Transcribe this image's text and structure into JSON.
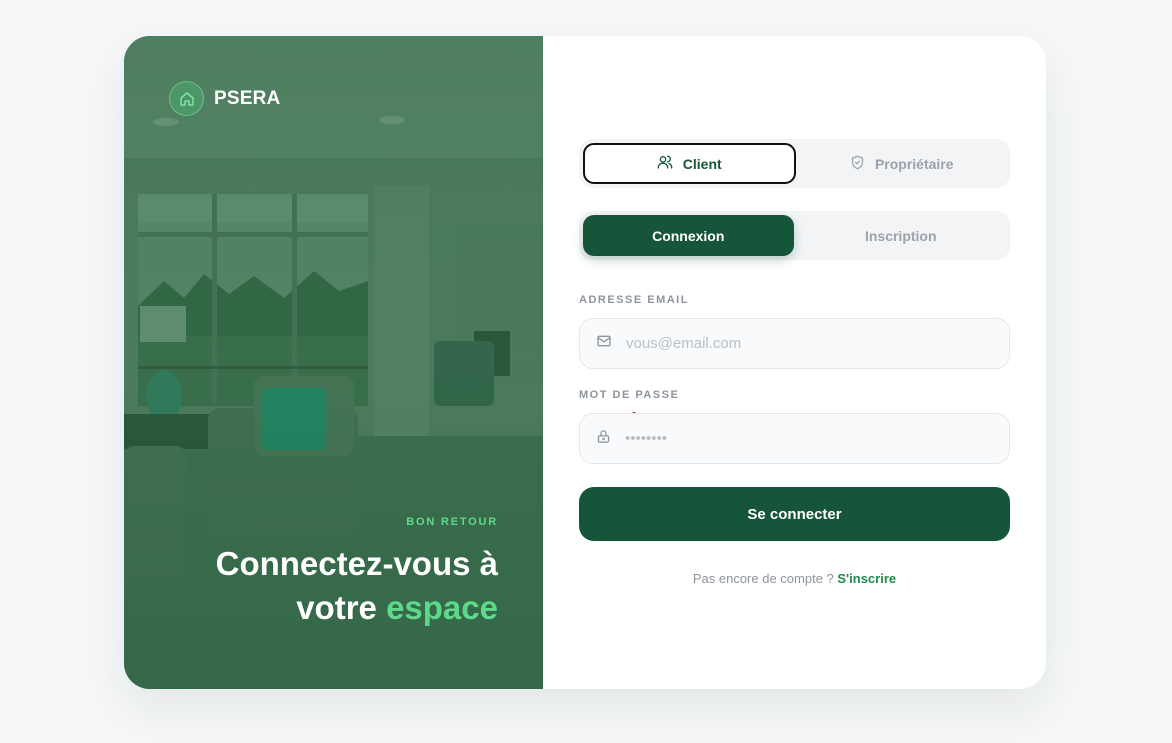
{
  "brand": {
    "name": "PSERA",
    "icon": "home-icon"
  },
  "hero": {
    "kicker": "BON RETOUR",
    "title_line1": "Connectez-vous à",
    "title_line2_plain": "votre ",
    "title_line2_accent": "espace"
  },
  "role_tabs": [
    {
      "label": "Client",
      "icon": "users-icon",
      "active": true
    },
    {
      "label": "Propriétaire",
      "icon": "shield-icon",
      "active": false
    }
  ],
  "mode_tabs": [
    {
      "label": "Connexion",
      "active": true
    },
    {
      "label": "Inscription",
      "active": false
    }
  ],
  "form": {
    "email_label": "ADRESSE EMAIL",
    "email_placeholder": "vous@email.com",
    "email_value": "",
    "password_label": "MOT DE PASSE",
    "password_placeholder": "••••••••",
    "password_value": "",
    "submit_label": "Se connecter"
  },
  "footer": {
    "prompt": "Pas encore de compte ? ",
    "link": "S'inscrire"
  },
  "colors": {
    "primary": "#17553a",
    "accent": "#5ed98a",
    "link": "#1f8a4c"
  }
}
